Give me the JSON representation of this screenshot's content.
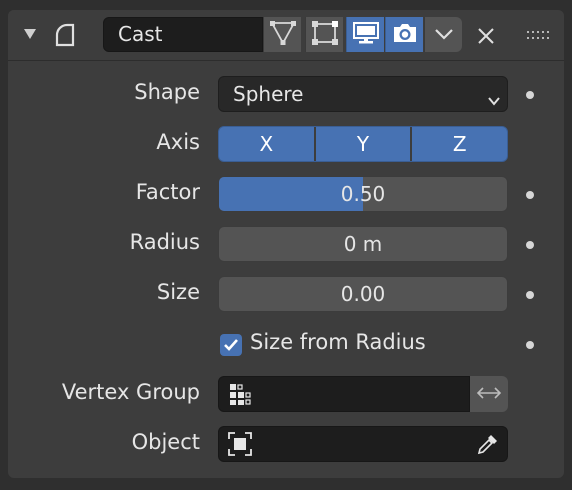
{
  "header": {
    "name_value": "Cast"
  },
  "props": {
    "shape_label": "Shape",
    "shape_value": "Sphere",
    "axis_label": "Axis",
    "axis": [
      {
        "label": "X",
        "active": true
      },
      {
        "label": "Y",
        "active": true
      },
      {
        "label": "Z",
        "active": true
      }
    ],
    "factor_label": "Factor",
    "factor_value": "0.50",
    "factor_fraction": 0.5,
    "radius_label": "Radius",
    "radius_value": "0 m",
    "size_label": "Size",
    "size_value": "0.00",
    "size_from_radius_label": "Size from Radius",
    "size_from_radius_checked": true,
    "vertex_group_label": "Vertex Group",
    "vertex_group_value": "",
    "object_label": "Object",
    "object_value": ""
  },
  "icons": {
    "collapse": "triangle-down-icon",
    "modifier": "cast-modifier-icon",
    "editmode": "edit-mode-icon",
    "cage": "on-cage-icon",
    "viewport": "viewport-display-icon",
    "render": "render-camera-icon",
    "dropdown": "chevron-down-icon",
    "close": "close-icon",
    "drag": "drag-handle-icon",
    "vgroup": "vertex-group-icon",
    "invert": "invert-arrows-icon",
    "object": "object-icon",
    "eyedropper": "eyedropper-icon"
  },
  "colors": {
    "accent": "#4772b3",
    "panel": "#3d3d3d",
    "field_dark": "#1d1d1d",
    "button_gray": "#545454"
  }
}
